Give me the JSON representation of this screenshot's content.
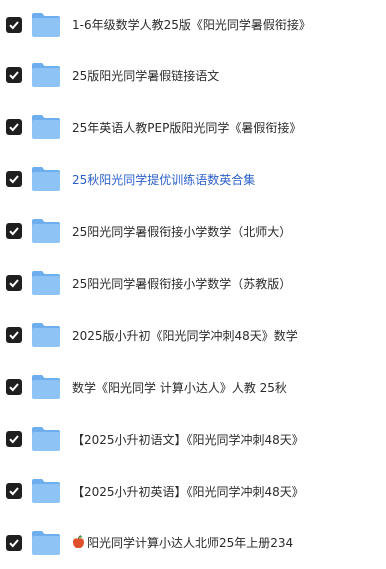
{
  "files": [
    {
      "name": "1-6年级数学人教25版《阳光同学暑假衔接》",
      "checked": true
    },
    {
      "name": "25版阳光同学暑假链接语文",
      "checked": true
    },
    {
      "name": "25年英语人教PEP版阳光同学《暑假衔接》",
      "checked": true
    },
    {
      "name": "25秋阳光同学提优训练语数英合集",
      "checked": true,
      "highlighted": true
    },
    {
      "name": "25阳光同学暑假衔接小学数学（北师大）",
      "checked": true
    },
    {
      "name": "25阳光同学暑假衔接小学数学（苏教版）",
      "checked": true
    },
    {
      "name": "2025版小升初《阳光同学冲刺48天》数学",
      "checked": true
    },
    {
      "name": "数学《阳光同学 计算小达人》人教 25秋",
      "checked": true
    },
    {
      "name": "【2025小升初语文】《阳光同学冲刺48天》",
      "checked": true
    },
    {
      "name": "【2025小升初英语】《阳光同学冲刺48天》",
      "checked": true
    },
    {
      "name": "阳光同学计算小达人北师25年上册234",
      "checked": true,
      "prefix_icon": "apple-icon"
    }
  ],
  "colors": {
    "folder_body": "#8ec3f5",
    "folder_tab": "#6eaeee",
    "checkbox": "#1f1f1f",
    "text": "#2b2b2b",
    "highlight_text": "#2a5fc9"
  }
}
